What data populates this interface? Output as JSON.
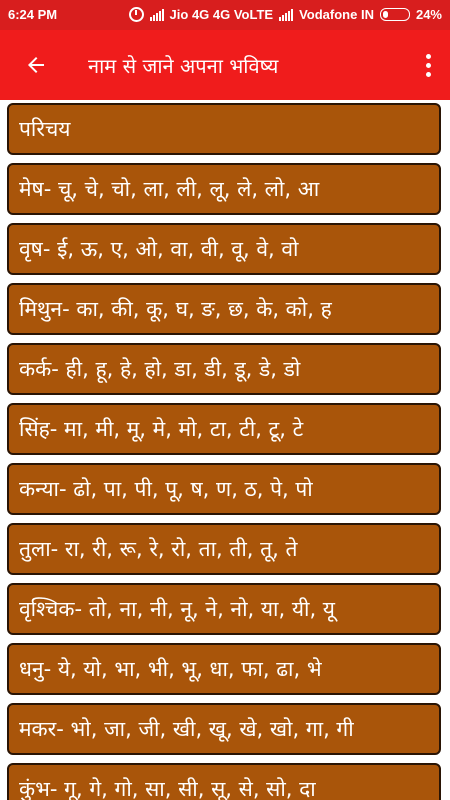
{
  "status_bar": {
    "time": "6:24 PM",
    "carrier_1": "Jio 4G 4G VoLTE",
    "carrier_2": "Vodafone IN",
    "battery": "24%",
    "battery_level": 0.24
  },
  "app_bar": {
    "title": "नाम से जाने अपना भविष्य"
  },
  "list": {
    "items": [
      {
        "label": "परिचय"
      },
      {
        "label": "मेष- चू, चे, चो, ला, ली, लू, ले, लो, आ"
      },
      {
        "label": "वृष- ई, ऊ, ए, ओ, वा, वी, वू, वे, वो"
      },
      {
        "label": "मिथुन- का, की, कू, घ, ङ, छ, के, को, ह"
      },
      {
        "label": "कर्क- ही, हू, हे, हो, डा, डी, डू, डे, डो"
      },
      {
        "label": "सिंह- मा, मी, मू, मे, मो, टा, टी, टू, टे"
      },
      {
        "label": "कन्या- ढो, पा, पी, पू, ष, ण, ठ, पे, पो"
      },
      {
        "label": "तुला- रा, री, रू, रे, रो, ता, ती, तू, ते"
      },
      {
        "label": "वृश्चिक- तो, ना, नी, नू, ने, नो, या, यी, यू"
      },
      {
        "label": "धनु- ये, यो, भा, भी, भू, धा, फा, ढा, भे"
      },
      {
        "label": "मकर- भो, जा, जी, खी, खू, खे, खो, गा, गी"
      },
      {
        "label": "कुंभ- गू, गे, गो, सा, सी, सू, से, सो, दा"
      }
    ]
  }
}
